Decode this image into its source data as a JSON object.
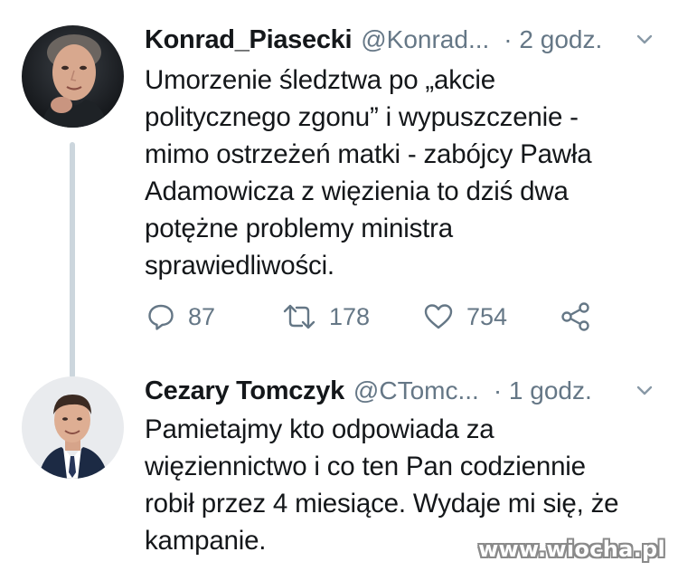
{
  "tweets": [
    {
      "author": {
        "name": "Konrad_Piasecki",
        "handle": "@Konrad...",
        "time": "· 2 godz."
      },
      "text_lines": [
        "Umorzenie śledztwa po „akcie",
        "politycznego zgonu” i wypuszczenie -",
        "mimo ostrzeżeń matki - zabójcy Pawła",
        "Adamowicza z więzienia to dziś dwa",
        "potężne problemy ministra",
        "sprawiedliwości."
      ],
      "actions": {
        "replies": "87",
        "retweets": "178",
        "likes": "754"
      }
    },
    {
      "author": {
        "name": "Cezary Tomczyk",
        "handle": "@CTomc...",
        "time": "· 1 godz."
      },
      "text_lines": [
        "Pamietajmy kto odpowiada za",
        "więziennictwo i co ten Pan codziennie",
        "robił przez 4 miesiące. Wydaje mi się, że",
        "kampanie."
      ]
    }
  ],
  "watermark": "www.wiocha.pl",
  "icons": {
    "reply": "reply-icon",
    "retweet": "retweet-icon",
    "like": "heart-icon",
    "share": "share-icon",
    "caret": "chevron-down-icon"
  },
  "colors": {
    "text": "#14171a",
    "secondary": "#657786",
    "thread_line": "#ccd6dd"
  }
}
